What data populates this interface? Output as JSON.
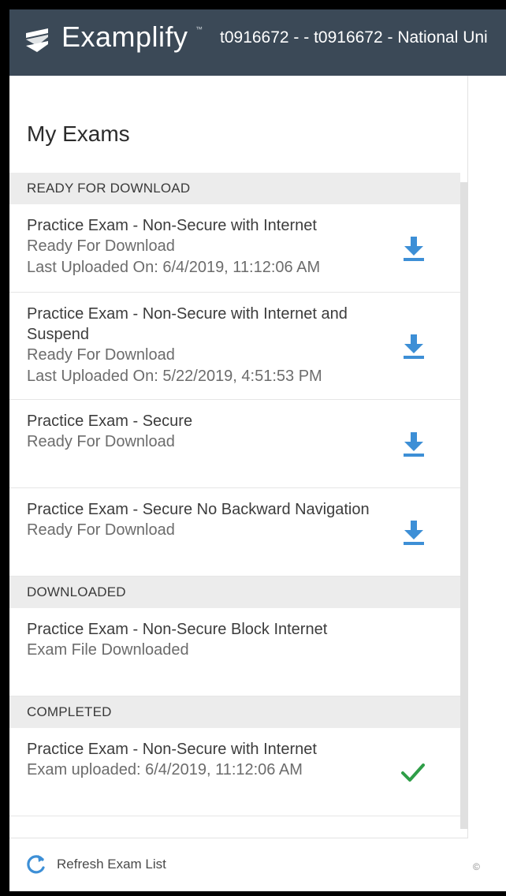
{
  "header": {
    "brand": "Examplify",
    "trademark": "™",
    "account": "t0916672 - - t0916672 - National Uni",
    "logo_icon": "examplify-logo-icon"
  },
  "page_title": "My Exams",
  "sections": {
    "ready": {
      "label": "READY FOR DOWNLOAD",
      "items": [
        {
          "title": "Practice Exam - Non-Secure with Internet",
          "status": "Ready For Download",
          "meta": "Last Uploaded On: 6/4/2019, 11:12:06 AM",
          "icon": "download-icon"
        },
        {
          "title": "Practice Exam - Non-Secure with Internet and Suspend",
          "status": "Ready For Download",
          "meta": "Last Uploaded On: 5/22/2019, 4:51:53 PM",
          "icon": "download-icon"
        },
        {
          "title": "Practice Exam - Secure",
          "status": "Ready For Download",
          "meta": "",
          "icon": "download-icon"
        },
        {
          "title": "Practice Exam - Secure No Backward Navigation",
          "status": "Ready For Download",
          "meta": "",
          "icon": "download-icon"
        }
      ]
    },
    "downloaded": {
      "label": "DOWNLOADED",
      "items": [
        {
          "title": "Practice Exam - Non-Secure Block Internet",
          "status": "Exam File Downloaded"
        }
      ]
    },
    "completed": {
      "label": "COMPLETED",
      "items": [
        {
          "title": "Practice Exam - Non-Secure with Internet",
          "status": "Exam uploaded: 6/4/2019, 11:12:06 AM",
          "icon": "checkmark-icon"
        }
      ]
    }
  },
  "footer": {
    "refresh_label": "Refresh Exam List",
    "refresh_icon": "refresh-icon",
    "corner_char": "©"
  },
  "colors": {
    "header_bg": "#3b4957",
    "accent_blue": "#3d8fd6",
    "check_green": "#2f9e48",
    "section_bg": "#ececec"
  }
}
